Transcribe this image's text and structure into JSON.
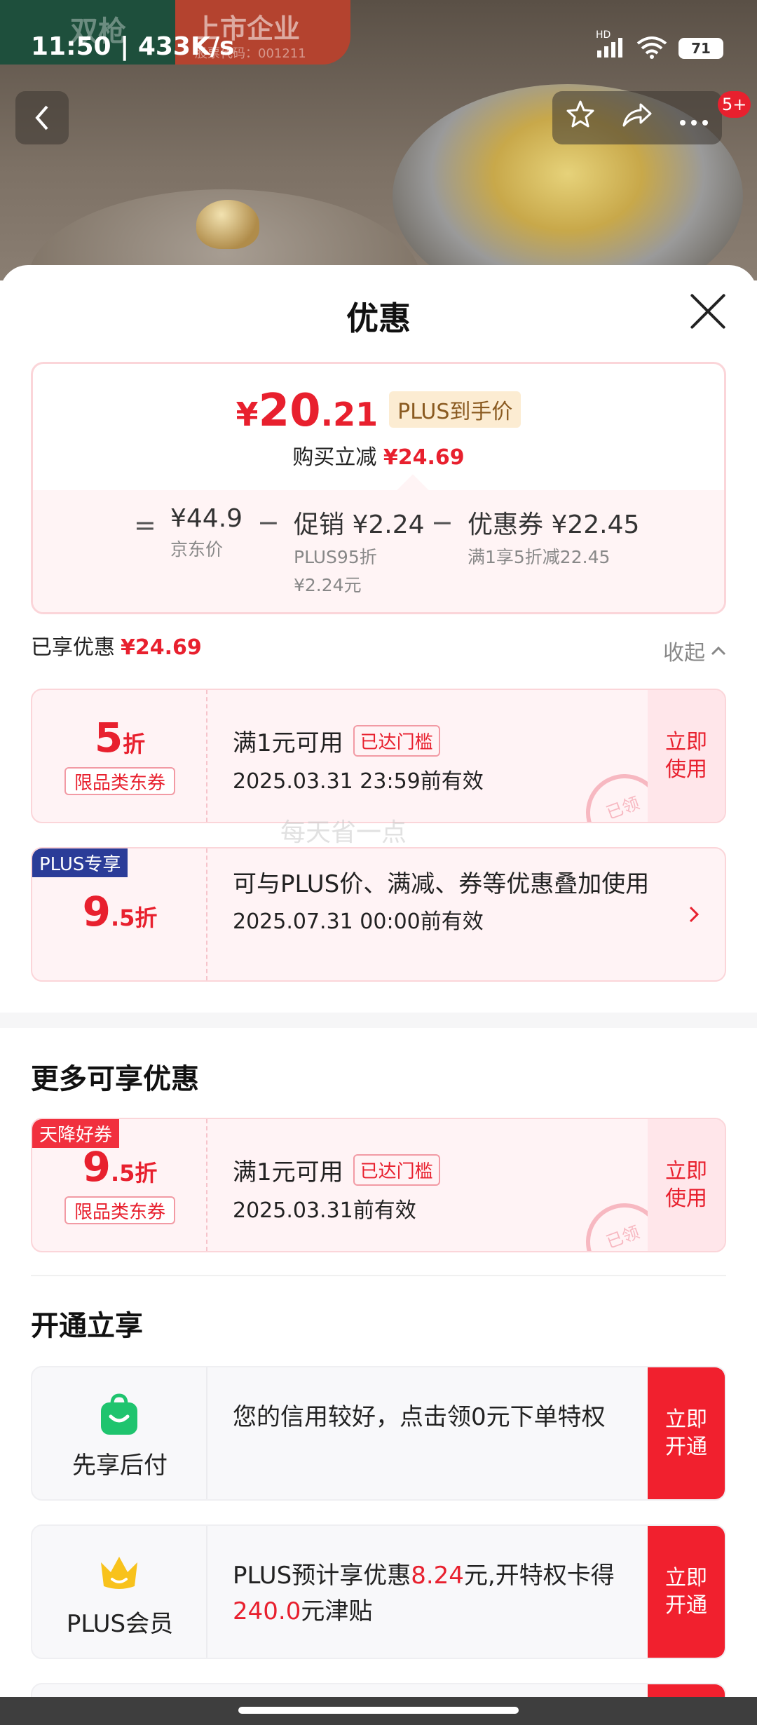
{
  "status_bar": {
    "time": "11:50",
    "speed": "433K/s",
    "network": "HD",
    "battery": "71"
  },
  "background": {
    "brand": "双枪",
    "listed_label": "上市企业",
    "listed_code": "股票代码：001211"
  },
  "top_nav": {
    "badge": "5+"
  },
  "sheet": {
    "title": "优惠",
    "price": {
      "yen": "¥",
      "integer": "20",
      "decimal": ".21",
      "plus_tag": "PLUS到手价",
      "save_label": "购买立减",
      "save_amount": "¥24.69",
      "breakdown": {
        "eq": "=",
        "jd_price": "¥44.9",
        "jd_label": "京东价",
        "minus1": "−",
        "promo_main": "促销 ¥2.24",
        "promo_sub1": "PLUS95折",
        "promo_sub2": "¥2.24元",
        "minus2": "−",
        "coupon_main": "优惠券 ¥22.45",
        "coupon_sub": "满1享5折减22.45"
      }
    },
    "enjoyed_label": "已享优惠",
    "enjoyed_amount": "¥24.69",
    "collapse_label": "收起",
    "coupons": [
      {
        "discount_big": "5",
        "discount_small": "折",
        "type": "限品类东券",
        "title": "满1元可用",
        "status": "已达门槛",
        "date": "2025.03.31 23:59前有效",
        "action": "立即使用",
        "stamp": "已领"
      },
      {
        "ribbon": "PLUS专享",
        "discount_big": "9",
        "discount_small": ".5折",
        "desc": "可与PLUS价、满减、券等优惠叠加使用",
        "date": "2025.07.31 00:00前有效"
      }
    ],
    "watermark": "每天省一点",
    "more_title": "更多可享优惠",
    "more_coupon": {
      "ribbon": "天降好券",
      "discount_big": "9",
      "discount_small": ".5折",
      "type": "限品类东券",
      "title": "满1元可用",
      "status": "已达门槛",
      "date": "2025.03.31前有效",
      "action": "立即使用",
      "stamp": "已领"
    },
    "open_title": "开通立享",
    "open_items": [
      {
        "name": "先享后付",
        "text": "您的信用较好，点击领0元下单特权",
        "action": "立即开通"
      },
      {
        "name": "PLUS会员",
        "text_pre": "PLUS预计享优惠",
        "amount1": "8.24",
        "text_mid": "元,开特权卡得",
        "amount2": "240.0",
        "text_post": "元津贴",
        "action": "立即开通"
      }
    ]
  },
  "colors": {
    "accent": "#e8202e",
    "plus_blue": "#2b3c98",
    "pay_green": "#1fc46e",
    "crown_yellow": "#f8c21c"
  },
  "icons": [
    "back-icon",
    "star-icon",
    "share-icon",
    "more-icon",
    "close-icon",
    "chevron-up-icon",
    "chevron-right-icon",
    "shopping-bag-icon",
    "crown-icon",
    "wifi-icon",
    "signal-icon",
    "battery-icon"
  ]
}
